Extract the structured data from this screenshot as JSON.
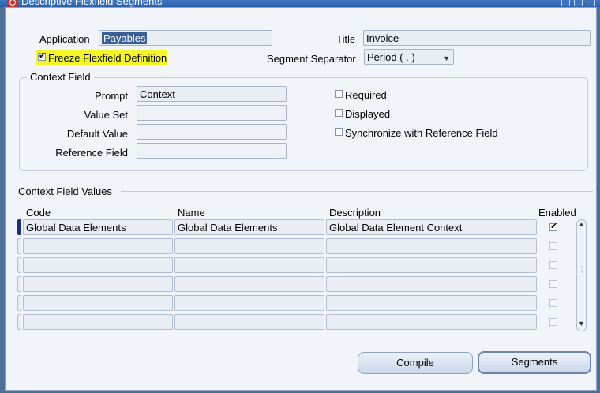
{
  "window": {
    "title": "Descriptive Flexfield Segments"
  },
  "header": {
    "application_label": "Application",
    "application_value": "Payables",
    "title_label": "Title",
    "title_value": "Invoice",
    "freeze_label": "Freeze Flexfield Definition",
    "freeze_checked": true,
    "separator_label": "Segment Separator",
    "separator_value": "Period ( . )"
  },
  "context_field": {
    "group_title": "Context Field",
    "prompt_label": "Prompt",
    "prompt_value": "Context",
    "value_set_label": "Value Set",
    "value_set_value": "",
    "default_value_label": "Default Value",
    "default_value_value": "",
    "reference_field_label": "Reference Field",
    "reference_field_value": "",
    "required_label": "Required",
    "displayed_label": "Displayed",
    "sync_label": "Synchronize with Reference Field"
  },
  "context_values": {
    "group_title": "Context Field Values",
    "columns": {
      "code": "Code",
      "name": "Name",
      "description": "Description",
      "enabled": "Enabled"
    },
    "rows": [
      {
        "code": "Global Data Elements",
        "name": "Global Data Elements",
        "description": "Global Data Element Context",
        "enabled": true
      },
      {
        "code": "",
        "name": "",
        "description": "",
        "enabled": false
      },
      {
        "code": "",
        "name": "",
        "description": "",
        "enabled": false
      },
      {
        "code": "",
        "name": "",
        "description": "",
        "enabled": false
      },
      {
        "code": "",
        "name": "",
        "description": "",
        "enabled": false
      },
      {
        "code": "",
        "name": "",
        "description": "",
        "enabled": false
      }
    ]
  },
  "buttons": {
    "compile": "Compile",
    "segments": "Segments"
  },
  "colors": {
    "highlight": "#f5f52a",
    "selection": "#3a5f96",
    "titlebar": "#2c5fa8"
  }
}
